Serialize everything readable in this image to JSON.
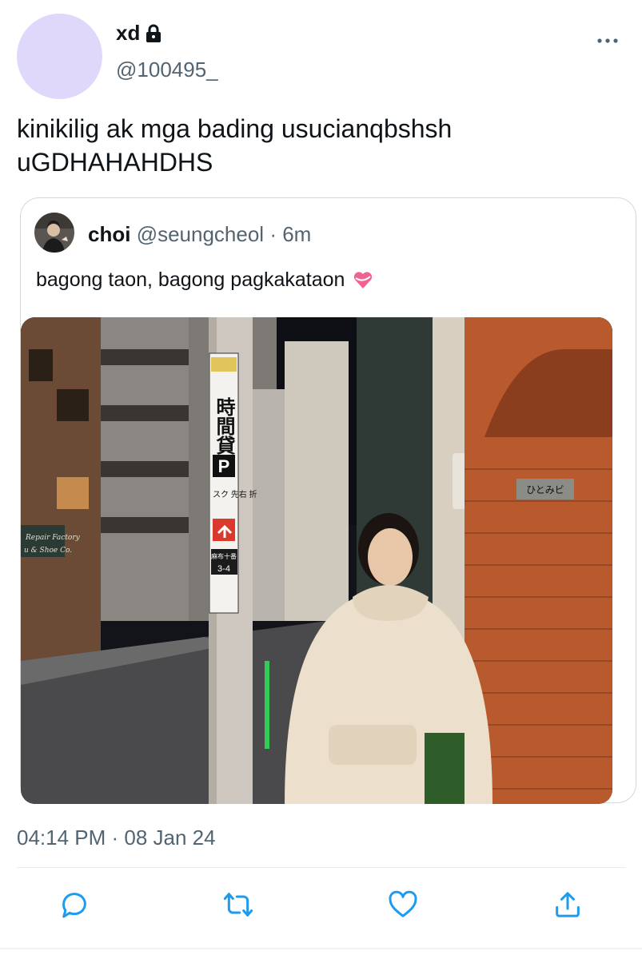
{
  "tweet": {
    "author": {
      "display_name": "xd",
      "handle": "@100495_",
      "locked": true,
      "avatar_color": "#e0d8fb"
    },
    "text": "kinikilig ak mga bading usucianqbshsh uGDHAHAHDHS",
    "timestamp": "04:14 PM · 08 Jan 24"
  },
  "quoted_tweet": {
    "author": {
      "display_name": "choi",
      "handle": "@seungcheol"
    },
    "separator": "·",
    "time_ago": "6m",
    "text": "bagong taon, bagong pagkakataon",
    "emoji": "heart-with-ribbon-icon",
    "photo": {
      "sign_kanji": "時間貸",
      "sign_p": "P",
      "sign_small": "スク 先右 折",
      "sign_bottom_line1": "麻布十番",
      "sign_bottom_line2": "3-4",
      "shop_sign_line1": "Repair Factory",
      "shop_sign_line2": "u & Shoe Co.",
      "wall_plaque": "ひとみビ"
    }
  },
  "actions": [
    {
      "name": "reply",
      "icon": "reply-icon"
    },
    {
      "name": "retweet",
      "icon": "retweet-icon"
    },
    {
      "name": "like",
      "icon": "heart-outline-icon"
    },
    {
      "name": "share",
      "icon": "share-icon"
    }
  ],
  "colors": {
    "primary_text": "#0f1419",
    "secondary_text": "#536471",
    "border": "#cfd9de",
    "action_icon": "#1d9bf0"
  }
}
